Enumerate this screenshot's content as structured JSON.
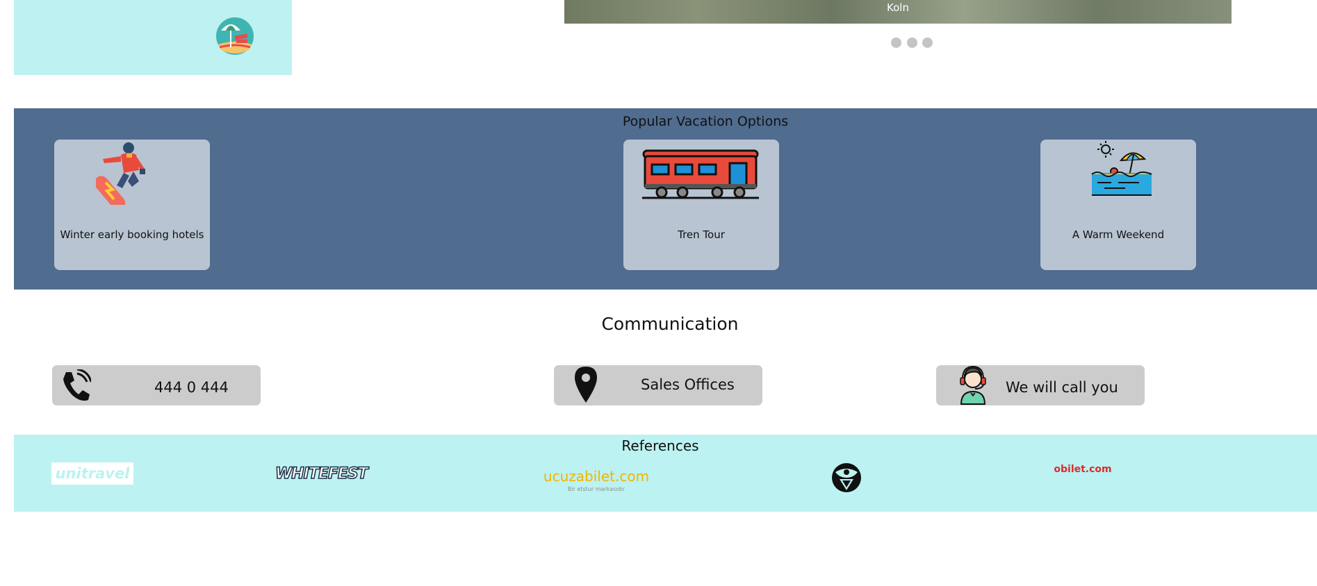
{
  "slider": {
    "caption": "Koln",
    "dots": [
      "1",
      "2",
      "3"
    ]
  },
  "popular": {
    "title": "Popular Vacation Options",
    "items": [
      {
        "label": "Winter early booking hotels",
        "icon": "snowboarder-icon"
      },
      {
        "label": "Tren Tour",
        "icon": "train-icon"
      },
      {
        "label": "A Warm Weekend",
        "icon": "beach-umbrella-icon"
      }
    ]
  },
  "communication": {
    "title": "Communication",
    "buttons": [
      {
        "label": "444 0 444",
        "icon": "phone-icon"
      },
      {
        "label": "Sales Offices",
        "icon": "location-pin-icon"
      },
      {
        "label": "We will call you",
        "icon": "support-agent-icon"
      }
    ]
  },
  "references": {
    "title": "References",
    "logos": [
      {
        "text": "unitravel",
        "color": "#ffffff"
      },
      {
        "text": "WHITEFEST",
        "color": "#1b2b44"
      },
      {
        "text": "ucuzabilet.com",
        "subtext": "Bir etstur markasıdır",
        "color": "#f2b400"
      },
      {
        "text": "tomorrowland-logo",
        "color": "#111111"
      },
      {
        "text": "obilet.com",
        "color": "#d92c2c"
      }
    ]
  },
  "colors": {
    "teal_band": "#bef1f1",
    "blue_band": "#506c8f",
    "card_bg": "#b8c4d1",
    "button_bg": "#cccccc"
  }
}
